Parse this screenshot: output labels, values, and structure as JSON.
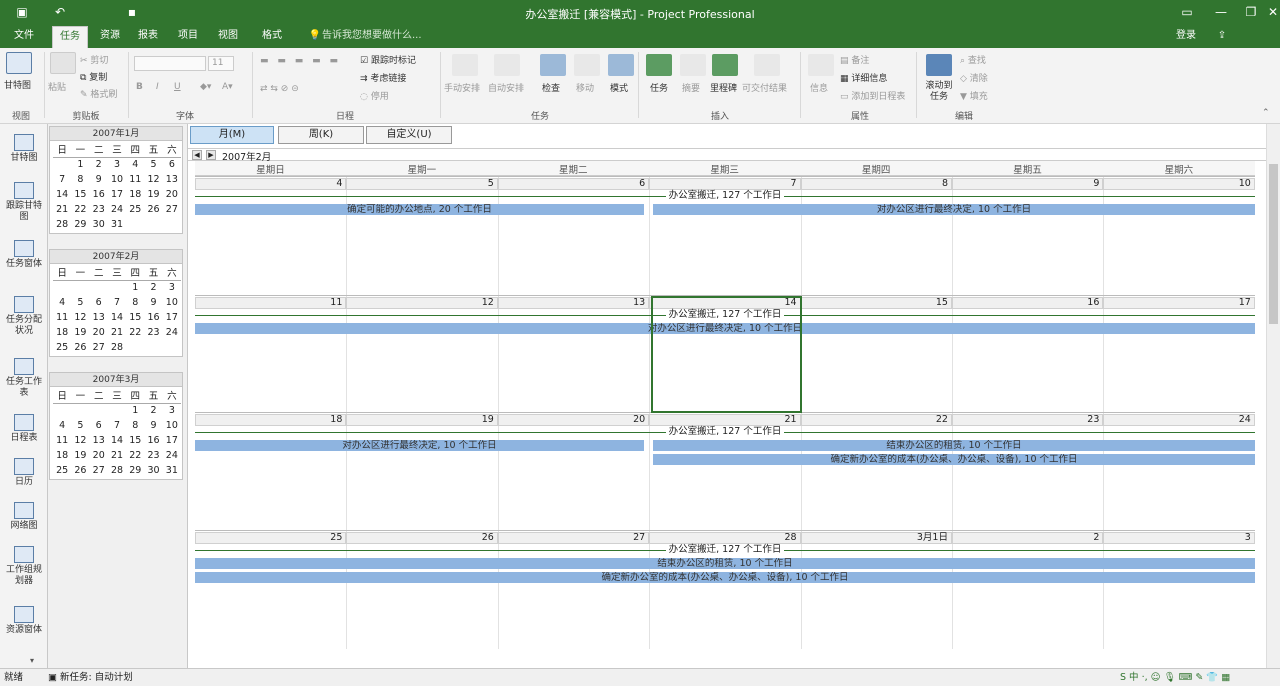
{
  "title": "办公室搬迁 [兼容模式] - Project Professional",
  "search_hint": "告诉我您想要做什么...",
  "login": "登录",
  "tabs": [
    "文件",
    "任务",
    "资源",
    "报表",
    "项目",
    "视图",
    "格式"
  ],
  "ribbon": {
    "gantt": "甘特图",
    "paste": "粘贴",
    "cut": "剪切",
    "copy": "复制",
    "format_painter": "格式刷",
    "font_size": "11",
    "mark_on_track": "跟踪时标记",
    "respect_links": "考虑链接",
    "inactivate": "停用",
    "manual": "手动安排",
    "auto": "自动安排",
    "inspect": "检查",
    "move": "移动",
    "mode": "模式",
    "task": "任务",
    "summary": "摘要",
    "milestone": "里程碑",
    "deliverable": "可交付结果",
    "info": "信息",
    "notes": "备注",
    "details": "详细信息",
    "add_timeline": "添加到日程表",
    "scroll_to_task": "滚动到任务",
    "find": "查找",
    "clear": "清除",
    "fill": "填充",
    "groups": [
      "视图",
      "剪贴板",
      "字体",
      "日程",
      "任务",
      "插入",
      "属性",
      "编辑"
    ]
  },
  "viewbar": [
    "甘特图",
    "跟踪甘特图",
    "任务窗体",
    "任务分配状况",
    "任务工作表",
    "日程表",
    "日历",
    "网络图",
    "工作组规划器",
    "资源窗体"
  ],
  "mini_calendars": [
    {
      "title": "2007年1月",
      "weekdays": [
        "日",
        "一",
        "二",
        "三",
        "四",
        "五",
        "六"
      ],
      "rows": [
        [
          "",
          "1",
          "2",
          "3",
          "4",
          "5",
          "6"
        ],
        [
          "7",
          "8",
          "9",
          "10",
          "11",
          "12",
          "13"
        ],
        [
          "14",
          "15",
          "16",
          "17",
          "18",
          "19",
          "20"
        ],
        [
          "21",
          "22",
          "23",
          "24",
          "25",
          "26",
          "27"
        ],
        [
          "28",
          "29",
          "30",
          "31",
          "",
          "",
          ""
        ]
      ]
    },
    {
      "title": "2007年2月",
      "weekdays": [
        "日",
        "一",
        "二",
        "三",
        "四",
        "五",
        "六"
      ],
      "rows": [
        [
          "",
          "",
          "",
          "",
          "1",
          "2",
          "3"
        ],
        [
          "4",
          "5",
          "6",
          "7",
          "8",
          "9",
          "10"
        ],
        [
          "11",
          "12",
          "13",
          "14",
          "15",
          "16",
          "17"
        ],
        [
          "18",
          "19",
          "20",
          "21",
          "22",
          "23",
          "24"
        ],
        [
          "25",
          "26",
          "27",
          "28",
          "",
          "",
          ""
        ]
      ]
    },
    {
      "title": "2007年3月",
      "weekdays": [
        "日",
        "一",
        "二",
        "三",
        "四",
        "五",
        "六"
      ],
      "rows": [
        [
          "",
          "",
          "",
          "",
          "1",
          "2",
          "3"
        ],
        [
          "4",
          "5",
          "6",
          "7",
          "8",
          "9",
          "10"
        ],
        [
          "11",
          "12",
          "13",
          "14",
          "15",
          "16",
          "17"
        ],
        [
          "18",
          "19",
          "20",
          "21",
          "22",
          "23",
          "24"
        ],
        [
          "25",
          "26",
          "27",
          "28",
          "29",
          "30",
          "31"
        ]
      ]
    }
  ],
  "view_buttons": [
    "月(M)",
    "周(K)",
    "自定义(U)"
  ],
  "current_month": "2007年2月",
  "day_headers": [
    "星期日",
    "星期一",
    "星期二",
    "星期三",
    "星期四",
    "星期五",
    "星期六"
  ],
  "weeks": [
    {
      "dates": [
        "4",
        "5",
        "6",
        "7",
        "8",
        "9",
        "10"
      ],
      "summary": "办公室搬迁, 127 个工作日",
      "bars": [
        {
          "label": "确定可能的办公地点, 20 个工作日"
        },
        {
          "label": "对办公区进行最终决定, 10 个工作日"
        }
      ]
    },
    {
      "dates": [
        "11",
        "12",
        "13",
        "14",
        "15",
        "16",
        "17"
      ],
      "summary": "办公室搬迁, 127 个工作日",
      "bars": [
        {
          "label": "对办公区进行最终决定, 10 个工作日"
        }
      ]
    },
    {
      "dates": [
        "18",
        "19",
        "20",
        "21",
        "22",
        "23",
        "24"
      ],
      "summary": "办公室搬迁, 127 个工作日",
      "bars": [
        {
          "label": "对办公区进行最终决定, 10 个工作日"
        },
        {
          "label": "结束办公区的租赁, 10 个工作日"
        },
        {
          "label": "确定新办公室的成本(办公桌、办公桌、设备), 10 个工作日"
        }
      ]
    },
    {
      "dates": [
        "25",
        "26",
        "27",
        "28",
        "3月1日",
        "2",
        "3"
      ],
      "summary": "办公室搬迁, 127 个工作日",
      "bars": [
        {
          "label": "结束办公区的租赁, 10 个工作日"
        },
        {
          "label": "确定新办公室的成本(办公桌、办公桌、设备), 10 个工作日"
        }
      ]
    }
  ],
  "status": {
    "ready": "就绪",
    "new_task": "新任务: 自动计划"
  },
  "colors": {
    "accent": "#31752f",
    "bar": "#8eb4e0"
  }
}
